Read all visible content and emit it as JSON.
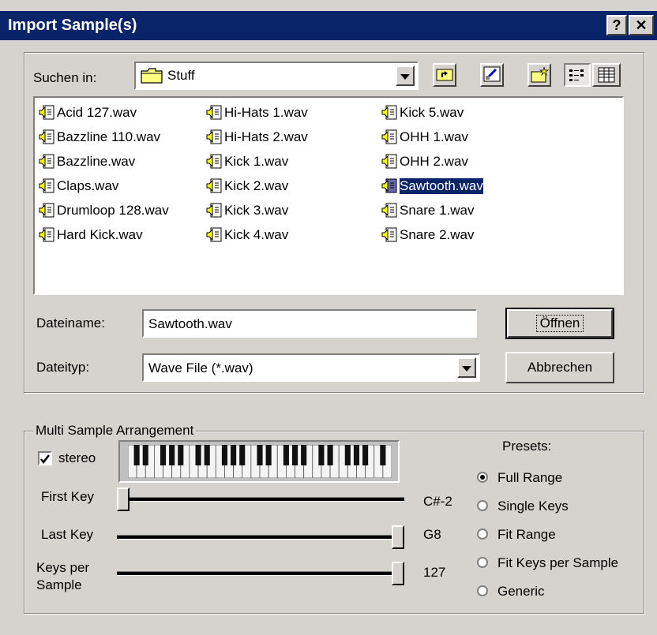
{
  "window": {
    "title": "Import Sample(s)",
    "help_label": "?",
    "close_label": "✕"
  },
  "lookin": {
    "label": "Suchen in:",
    "value": "Stuff"
  },
  "toolbar": {
    "up_icon": "folder-up-icon",
    "desktop_icon": "desktop-icon",
    "newfolder_icon": "new-folder-icon",
    "list_icon": "list-view-icon",
    "details_icon": "details-view-icon"
  },
  "files": [
    {
      "name": "Acid 127.wav"
    },
    {
      "name": "Bazzline 110.wav"
    },
    {
      "name": "Bazzline.wav"
    },
    {
      "name": "Claps.wav"
    },
    {
      "name": "Drumloop 128.wav"
    },
    {
      "name": "Hard Kick.wav"
    },
    {
      "name": "Hi-Hats 1.wav"
    },
    {
      "name": "Hi-Hats 2.wav"
    },
    {
      "name": "Kick 1.wav"
    },
    {
      "name": "Kick 2.wav"
    },
    {
      "name": "Kick 3.wav"
    },
    {
      "name": "Kick 4.wav"
    },
    {
      "name": "Kick 5.wav"
    },
    {
      "name": "OHH 1.wav"
    },
    {
      "name": "OHH 2.wav"
    },
    {
      "name": "Sawtooth.wav",
      "selected": true
    },
    {
      "name": "Snare 1.wav"
    },
    {
      "name": "Snare 2.wav"
    }
  ],
  "filename": {
    "label": "Dateiname:",
    "value": "Sawtooth.wav"
  },
  "filetype": {
    "label": "Dateityp:",
    "value": "Wave File (*.wav)"
  },
  "buttons": {
    "open": "Öffnen",
    "cancel": "Abbrechen"
  },
  "msa": {
    "title": "Multi Sample Arrangement",
    "stereo_label": "stereo",
    "stereo_checked": true,
    "first_key_label": "First Key",
    "first_key_value": "C#-2",
    "first_key_level": 0.0,
    "last_key_label": "Last Key",
    "last_key_value": "G8",
    "last_key_level": 1.0,
    "kps_label_1": "Keys per",
    "kps_label_2": "Sample",
    "kps_value": "127",
    "kps_level": 1.0,
    "presets_title": "Presets:",
    "presets": [
      {
        "label": "Full Range",
        "selected": true
      },
      {
        "label": "Single Keys",
        "selected": false
      },
      {
        "label": "Fit Range",
        "selected": false
      },
      {
        "label": "Fit Keys per Sample",
        "selected": false
      },
      {
        "label": "Generic",
        "selected": false
      }
    ]
  }
}
